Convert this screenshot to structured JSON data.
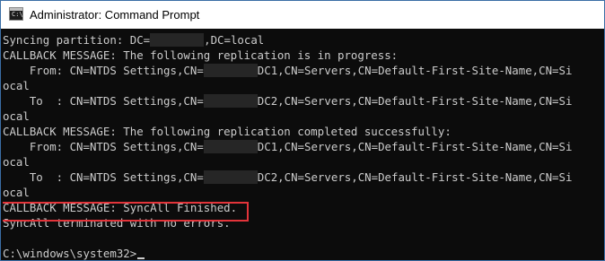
{
  "window": {
    "title": "Administrator: Command Prompt",
    "app_icon_glyph": "C:\\",
    "accent_color": "#3a6ea5",
    "highlight_color": "#e3343a"
  },
  "console": {
    "lines": [
      "Syncing partition: DC=",
      ",DC=local",
      "CALLBACK MESSAGE: The following replication is in progress:",
      "    From: CN=NTDS Settings,CN=",
      "DC1,CN=Servers,CN=Default-First-Site-Name,CN=Si",
      "ocal",
      "    To  : CN=NTDS Settings,CN=",
      "DC2,CN=Servers,CN=Default-First-Site-Name,CN=Si",
      "ocal",
      "CALLBACK MESSAGE: The following replication completed successfully:",
      "    From: CN=NTDS Settings,CN=",
      "DC1,CN=Servers,CN=Default-First-Site-Name,CN=Si",
      "ocal",
      "    To  : CN=NTDS Settings,CN=",
      "DC2,CN=Servers,CN=Default-First-Site-Name,CN=Si",
      "ocal",
      "CALLBACK MESSAGE: SyncAll Finished.",
      "SyncAll terminated with no errors.",
      "C:\\windows\\system32>"
    ]
  }
}
